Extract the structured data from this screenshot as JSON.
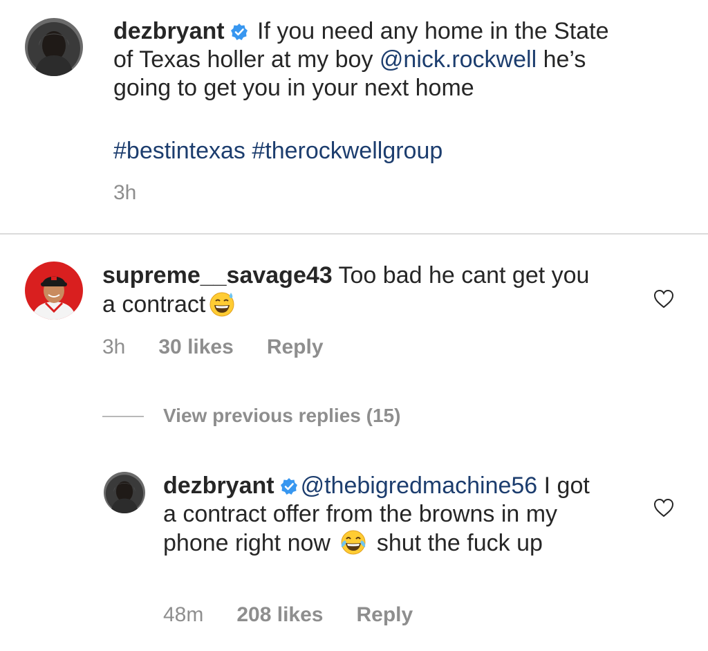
{
  "caption": {
    "username": "dezbryant",
    "text_before_mention": " If you need any home in the State of Texas holler at my boy ",
    "mention": "@nick.rockwell",
    "text_after_mention": " he’s going to get you in your next home",
    "hashtags": "#bestintexas #therockwellgroup",
    "time": "3h"
  },
  "comment": {
    "username": "supreme__savage43",
    "text": " Too bad he cant get you a contract",
    "emoji": "grinning-face-with-sweat-emoji",
    "time": "3h",
    "likes": "30 likes",
    "reply_label": "Reply"
  },
  "view_replies": {
    "label": "View previous replies (15)"
  },
  "reply": {
    "username": "dezbryant",
    "mention": "@thebigredmachine56",
    "text_part1": " I got a contract offer from the browns in my phone right now ",
    "emoji": "face-with-tears-of-joy-emoji",
    "text_part2": " shut the fuck up",
    "time": "48m",
    "likes": "208 likes",
    "reply_label": "Reply"
  },
  "colors": {
    "text": "#262626",
    "link": "#1c3d6e",
    "meta": "#8e8e8e",
    "verified": "#3897f0",
    "divider": "#dbdbdb"
  }
}
